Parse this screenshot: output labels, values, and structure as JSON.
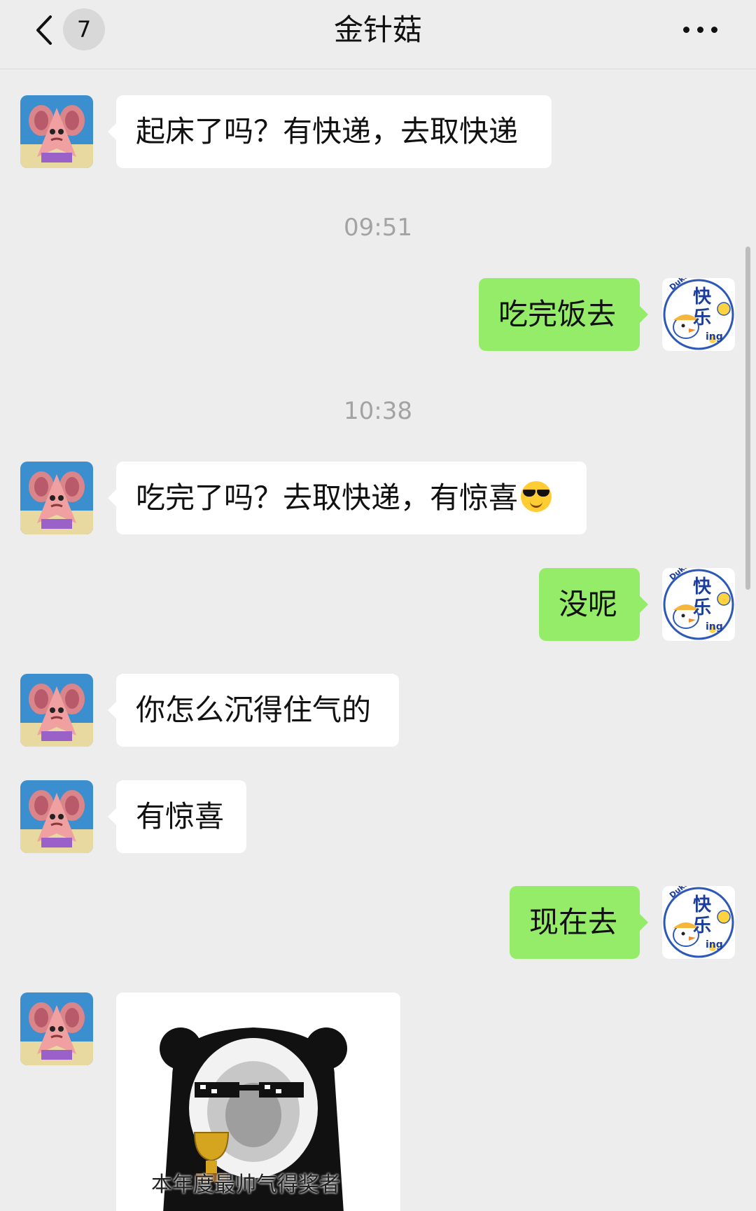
{
  "header": {
    "back_label": "返回",
    "unread_count": "7",
    "title": "金针菇"
  },
  "messages": [
    {
      "type": "in",
      "text": "起床了吗？有快递，去取快递"
    },
    {
      "type": "time",
      "text": "09:51"
    },
    {
      "type": "out",
      "text": "吃完饭去"
    },
    {
      "type": "time",
      "text": "10:38"
    },
    {
      "type": "in",
      "text": "吃完了吗？去取快递，有惊喜",
      "emoji": "smiling-face-with-sunglasses"
    },
    {
      "type": "out",
      "text": "没呢"
    },
    {
      "type": "in",
      "text": "你怎么沉得住气的"
    },
    {
      "type": "in",
      "text": "有惊喜"
    },
    {
      "type": "out",
      "text": "现在去"
    },
    {
      "type": "in-sticker",
      "caption": "本年度最帅气得奖者"
    }
  ],
  "my_avatar_text": "快乐",
  "my_avatar_sub": "ing",
  "my_avatar_brand": "DukeDuck",
  "colors": {
    "background": "#ededed",
    "incoming_bubble": "#ffffff",
    "outgoing_bubble": "#95ec69",
    "timestamp": "#a3a3a3"
  }
}
